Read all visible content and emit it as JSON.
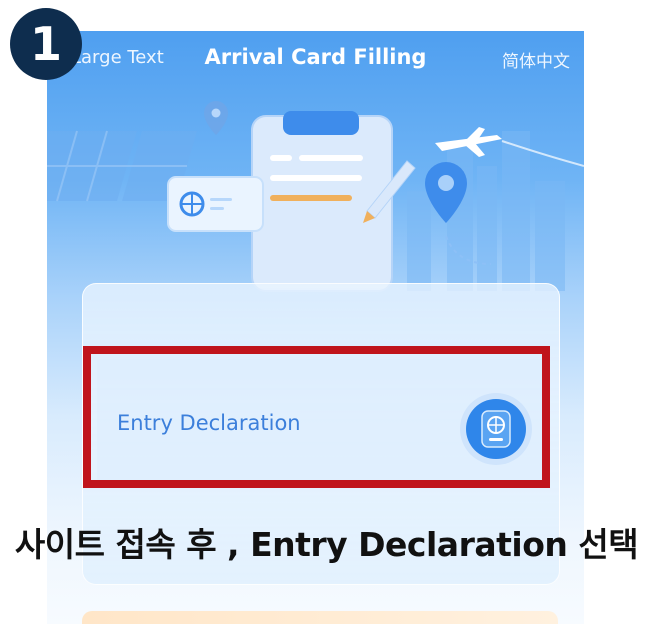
{
  "header": {
    "large_text": "Large Text",
    "title": "Arrival Card Filling",
    "language": "简体中文"
  },
  "card": {
    "entry_declaration_label": "Entry Declaration",
    "entry_declaration_icon": "passport-globe-icon"
  },
  "annotation": {
    "step_number": "1",
    "caption": "사이트 접속 후 , Entry Declaration 선택",
    "highlight_color": "#c0141c",
    "badge_color": "#0e2d4e"
  },
  "colors": {
    "accent_blue": "#3c7fdb",
    "header_blue": "#4f9ff0"
  }
}
